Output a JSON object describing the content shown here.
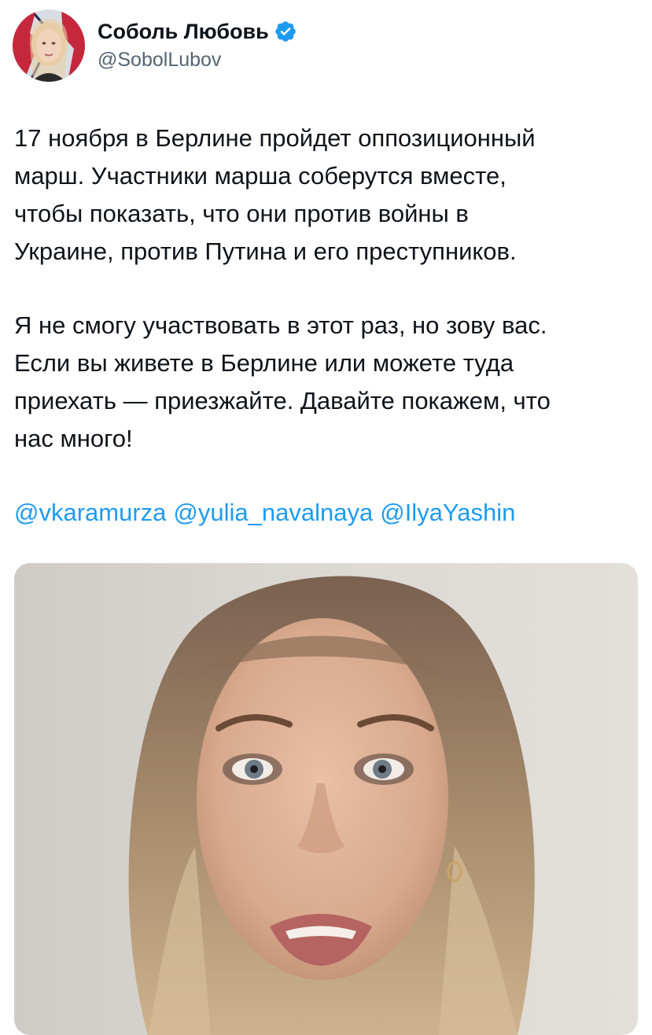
{
  "author": {
    "display_name": "Соболь Любовь",
    "handle": "@SobolLubov",
    "verified_icon": "verified-badge-icon",
    "verified_color": "#1d9bf0"
  },
  "tweet": {
    "paragraphs": [
      {
        "lines": [
          "17 ноября в Берлине пройдет оппозиционный",
          "марш. Участники марша соберутся вместе,",
          "чтобы показать, что они против войны в",
          "Украине, против Путина и его преступников."
        ]
      },
      {
        "lines": [
          "Я не смогу участвовать в этот раз, но зову вас.",
          "Если вы живете в Берлине или можете туда",
          "приехать — приезжайте. Давайте покажем, что",
          "нас много!"
        ]
      }
    ],
    "mentions": [
      "@vkaramurza",
      "@yulia_navalnaya",
      "@IlyaYashin"
    ]
  },
  "colors": {
    "text": "#0f1419",
    "secondary": "#536471",
    "link": "#1d9bf0"
  }
}
